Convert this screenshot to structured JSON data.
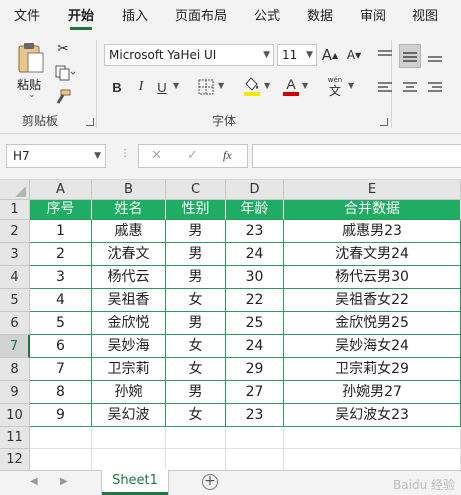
{
  "tabs": [
    "文件",
    "开始",
    "插入",
    "页面布局",
    "公式",
    "数据",
    "审阅",
    "视图"
  ],
  "active_tab": "开始",
  "ribbon": {
    "paste_label": "粘贴",
    "clipboard_label": "剪贴板",
    "font_group_label": "字体",
    "font_name": "Microsoft YaHei UI",
    "font_size": "11",
    "bold": "B",
    "italic": "I",
    "underline": "U",
    "font_color_letter": "A",
    "wen_label": "wén",
    "wen_char": "文",
    "grow_font": "A",
    "shrink_font": "A",
    "font_color": "#d00000",
    "fill_color": "#ffe600"
  },
  "formula_bar": {
    "name_box": "H7",
    "fx": "fx",
    "cancel": "✕",
    "confirm": "✓",
    "formula": ""
  },
  "columns": [
    "A",
    "B",
    "C",
    "D",
    "E"
  ],
  "rows": [
    "1",
    "2",
    "3",
    "4",
    "5",
    "6",
    "7",
    "8",
    "9",
    "10",
    "11",
    "12"
  ],
  "header_row": [
    "序号",
    "姓名",
    "性别",
    "年龄",
    "合并数据"
  ],
  "data_rows": [
    [
      "1",
      "戚惠",
      "男",
      "23",
      "戚惠男23"
    ],
    [
      "2",
      "沈春文",
      "男",
      "24",
      "沈春文男24"
    ],
    [
      "3",
      "杨代云",
      "男",
      "30",
      "杨代云男30"
    ],
    [
      "4",
      "吴祖香",
      "女",
      "22",
      "吴祖香女22"
    ],
    [
      "5",
      "金欣悦",
      "男",
      "25",
      "金欣悦男25"
    ],
    [
      "6",
      "吴妙海",
      "女",
      "24",
      "吴妙海女24"
    ],
    [
      "7",
      "卫宗莉",
      "女",
      "29",
      "卫宗莉女29"
    ],
    [
      "8",
      "孙婉",
      "男",
      "27",
      "孙婉男27"
    ],
    [
      "9",
      "吴幻波",
      "女",
      "23",
      "吴幻波女23"
    ]
  ],
  "selected_row": "7",
  "sheet_tab": "Sheet1",
  "add_sheet": "+",
  "watermark": "Baidu 经验",
  "colors": {
    "accent": "#217346",
    "header_fill": "#1fad63"
  }
}
